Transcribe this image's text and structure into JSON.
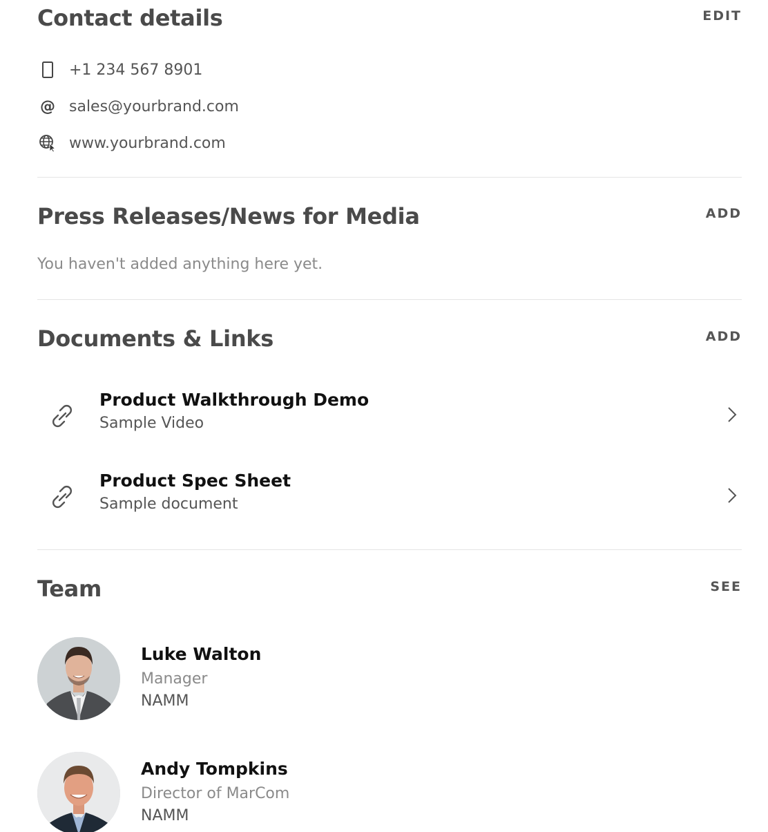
{
  "contact": {
    "title": "Contact details",
    "action": "EDIT",
    "phone": "+1 234 567 8901",
    "email": "sales@yourbrand.com",
    "website": "www.yourbrand.com",
    "icons": [
      "phone-icon",
      "at-sign-icon",
      "globe-icon"
    ]
  },
  "press": {
    "title": "Press Releases/News for Media",
    "action": "ADD",
    "empty_text": "You haven't added anything here yet."
  },
  "documents": {
    "title": "Documents & Links",
    "action": "ADD",
    "items": [
      {
        "title": "Product Walkthrough Demo",
        "subtitle": "Sample Video",
        "icon": "link-icon"
      },
      {
        "title": "Product Spec Sheet",
        "subtitle": "Sample document",
        "icon": "link-icon"
      }
    ]
  },
  "team": {
    "title": "Team",
    "action": "SEE",
    "members": [
      {
        "name": "Luke Walton",
        "role": "Manager",
        "org": "NAMM"
      },
      {
        "name": "Andy Tompkins",
        "role": "Director of MarCom",
        "org": "NAMM"
      }
    ]
  },
  "colors": {
    "heading": "#4a4a4a",
    "body": "#555555",
    "muted": "#8a8a8a",
    "divider": "#e4e4e4"
  }
}
